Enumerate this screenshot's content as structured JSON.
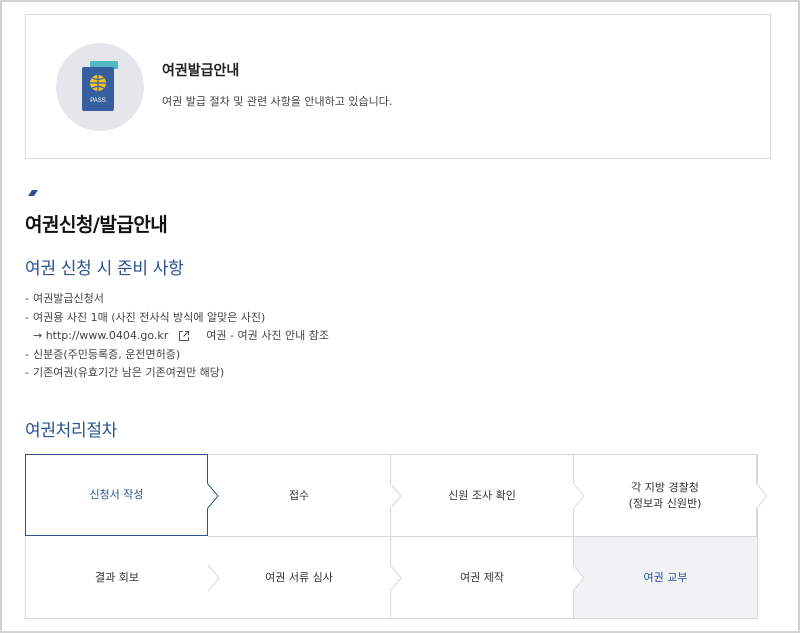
{
  "info": {
    "title": "여권발급안내",
    "description": "여권 발급 절차 및 관련 사항을 안내하고 있습니다.",
    "icon_text": "PASS"
  },
  "section": {
    "title": "여권신청/발급안내",
    "prep_title": "여권 신청 시 준비 사항",
    "prep_items": [
      "여권발급신청서",
      "여권용 사진 1매 (사진 전사식 방식에 알맞은 사진)",
      "신분증(주민등록증, 운전면허증)",
      "기존여권(유효기간 남은 기존여권만 해당)"
    ],
    "photo_link": "→ http://www.0404.go.kr",
    "photo_link_note": "여권 - 여권 사진 안내 참조",
    "process_title": "여권처리절차"
  },
  "process_steps": [
    {
      "label": "신청서 작성",
      "state": "active"
    },
    {
      "label": "접수",
      "state": "normal"
    },
    {
      "label": "신원 조사 확인",
      "state": "normal"
    },
    {
      "label": "각 지방 경찰청\n(정보과 신원반)",
      "state": "normal"
    },
    {
      "label": "결과 회보",
      "state": "normal"
    },
    {
      "label": "여권 서류 심사",
      "state": "normal"
    },
    {
      "label": "여권 제작",
      "state": "normal"
    },
    {
      "label": "여권 교부",
      "state": "done"
    }
  ],
  "colors": {
    "accent": "#2c5292",
    "passport_blue": "#355f9e",
    "passport_teal": "#4fb9c4",
    "globe_gold": "#f3c22b",
    "circle_bg": "#e4e6ea"
  }
}
